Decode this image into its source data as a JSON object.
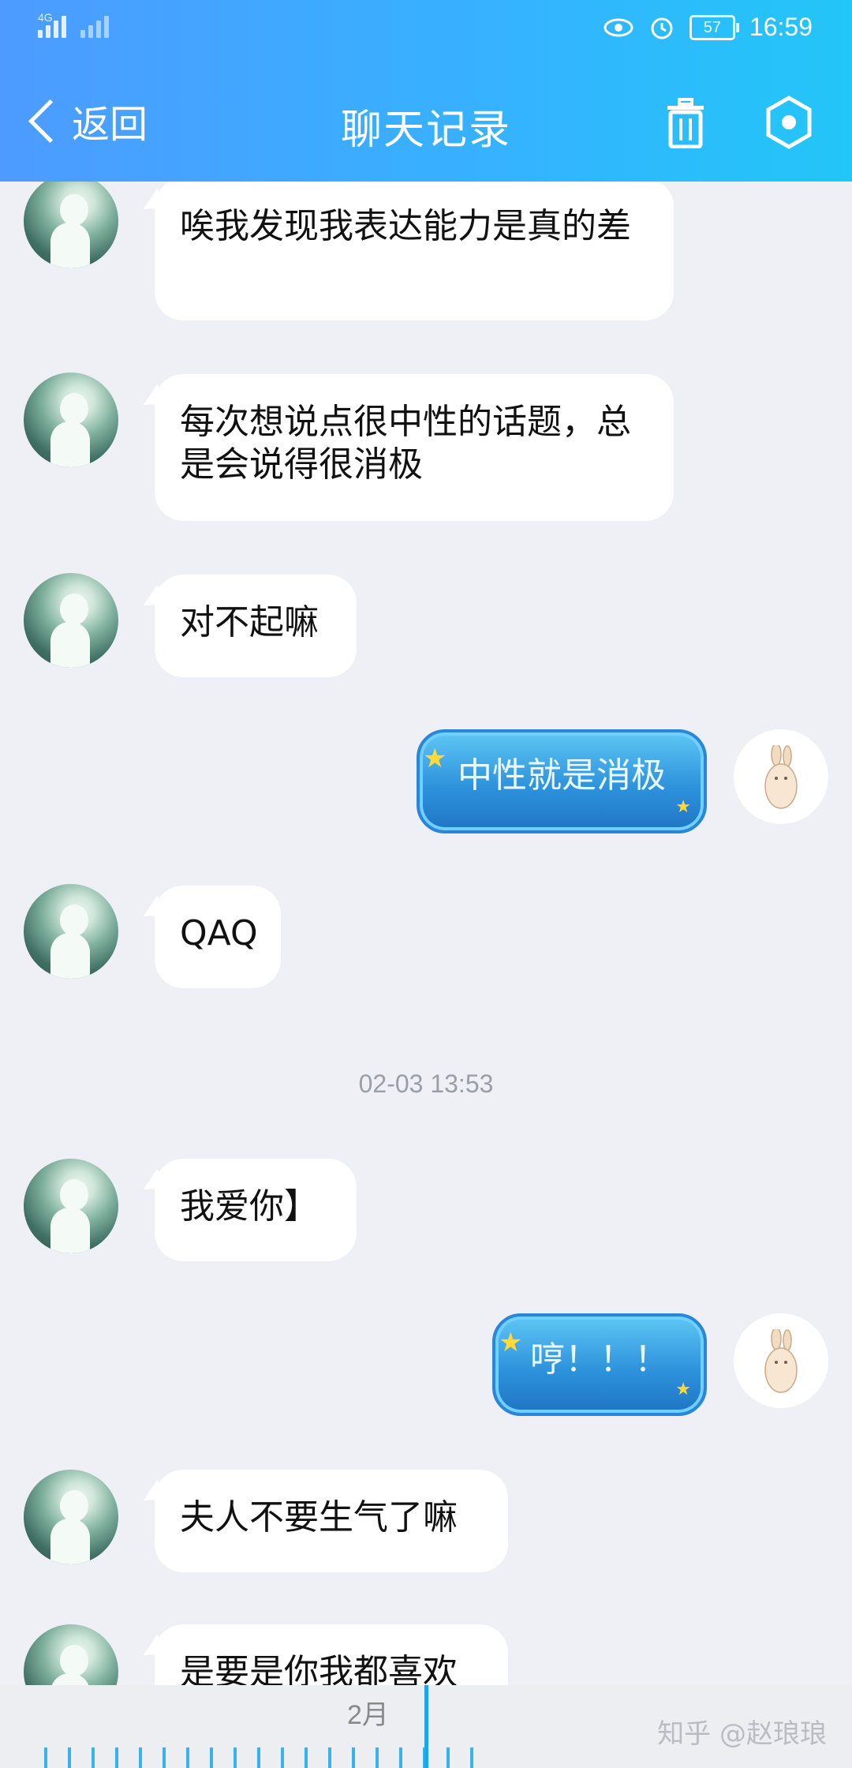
{
  "status_bar": {
    "network": "4G",
    "battery": "57",
    "time": "16:59"
  },
  "header": {
    "back_label": "返回",
    "title": "聊天记录"
  },
  "messages": [
    {
      "text": "唉我发现我表达能力是真的差"
    },
    {
      "text": "每次想说点很中性的话题，总是会说得很消极"
    },
    {
      "text": "对不起嘛"
    },
    {
      "text": "中性就是消极"
    },
    {
      "text": "QAQ"
    },
    {
      "text": "我爱你】"
    },
    {
      "text": "哼！！！"
    },
    {
      "text": "夫人不要生气了嘛"
    },
    {
      "text": "是要是你我都喜欢"
    }
  ],
  "timestamp": "02-03 13:53",
  "ruler": {
    "month": "2月"
  },
  "watermark": "知乎 @赵琅琅",
  "colors": {
    "header_start": "#4d9bff",
    "header_end": "#22c6f8",
    "background": "#eef0f5",
    "accent": "#1aa6e8"
  }
}
